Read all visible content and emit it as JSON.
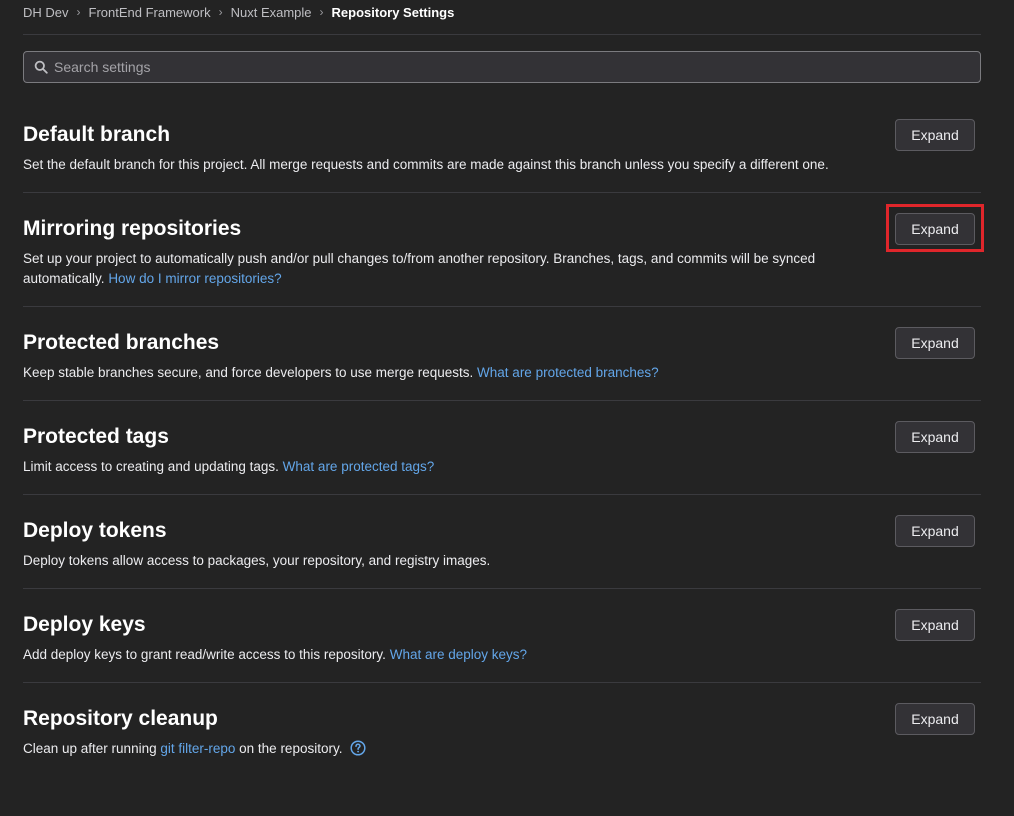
{
  "breadcrumb": {
    "items": [
      "DH Dev",
      "FrontEnd Framework",
      "Nuxt Example"
    ],
    "current": "Repository Settings",
    "separator": "›"
  },
  "search": {
    "placeholder": "Search settings",
    "value": ""
  },
  "sections": [
    {
      "title": "Default branch",
      "description": "Set the default branch for this project. All merge requests and commits are made against this branch unless you specify a different one.",
      "link": "",
      "button": "Expand"
    },
    {
      "title": "Mirroring repositories",
      "description": "Set up your project to automatically push and/or pull changes to/from another repository. Branches, tags, and commits will be synced automatically.",
      "link": "How do I mirror repositories?",
      "button": "Expand"
    },
    {
      "title": "Protected branches",
      "description": "Keep stable branches secure, and force developers to use merge requests.",
      "link": "What are protected branches?",
      "button": "Expand"
    },
    {
      "title": "Protected tags",
      "description": "Limit access to creating and updating tags.",
      "link": "What are protected tags?",
      "button": "Expand"
    },
    {
      "title": "Deploy tokens",
      "description": "Deploy tokens allow access to packages, your repository, and registry images.",
      "link": "",
      "button": "Expand"
    },
    {
      "title": "Deploy keys",
      "description": "Add deploy keys to grant read/write access to this repository.",
      "link": "What are deploy keys?",
      "button": "Expand"
    },
    {
      "title": "Repository cleanup",
      "description_before": "Clean up after running",
      "description_link": "git filter-repo",
      "description_after": "on the repository.",
      "button": "Expand"
    }
  ],
  "colors": {
    "background": "#232323",
    "link": "#63a6e9",
    "highlight": "#e0262b"
  }
}
